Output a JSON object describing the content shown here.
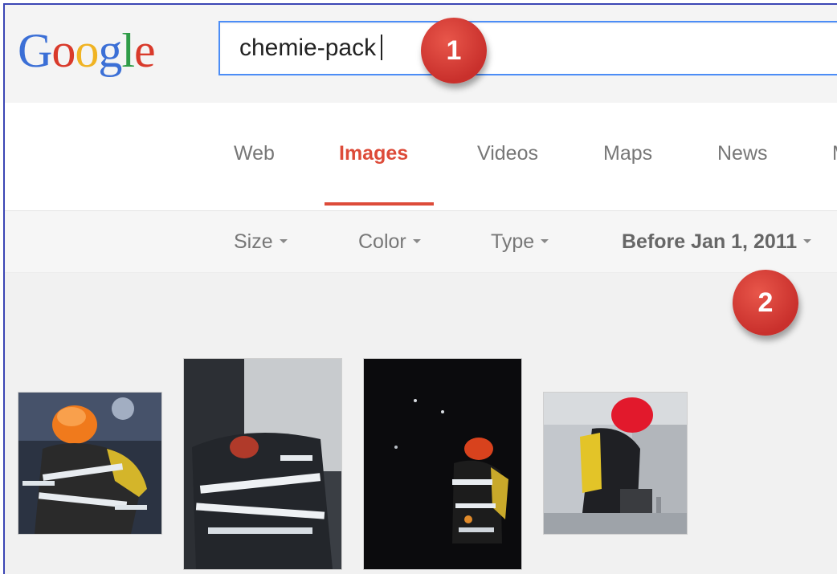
{
  "logo": {
    "letters": [
      "G",
      "o",
      "o",
      "g",
      "l",
      "e"
    ],
    "colors": [
      "#3b6fd6",
      "#d93a2b",
      "#f0b323",
      "#3b6fd6",
      "#2f9c48",
      "#d93a2b"
    ]
  },
  "search": {
    "value": "chemie-pack"
  },
  "tabs": [
    {
      "label": "Web",
      "active": false
    },
    {
      "label": "Images",
      "active": true
    },
    {
      "label": "Videos",
      "active": false
    },
    {
      "label": "Maps",
      "active": false
    },
    {
      "label": "News",
      "active": false
    },
    {
      "label": "M",
      "active": false
    }
  ],
  "filters": [
    {
      "label": "Size"
    },
    {
      "label": "Color"
    },
    {
      "label": "Type"
    },
    {
      "label": "Before Jan 1, 2011"
    }
  ],
  "markers": [
    {
      "label": "1"
    },
    {
      "label": "2"
    }
  ],
  "accent_color": "#dd4b39",
  "results": [
    {
      "subject": "firefighter with orange helmet"
    },
    {
      "subject": "firefighters with reflective stripes"
    },
    {
      "subject": "firefighter in dark with red helmet"
    },
    {
      "subject": "firefighter with red helmet and yellow tank"
    }
  ]
}
